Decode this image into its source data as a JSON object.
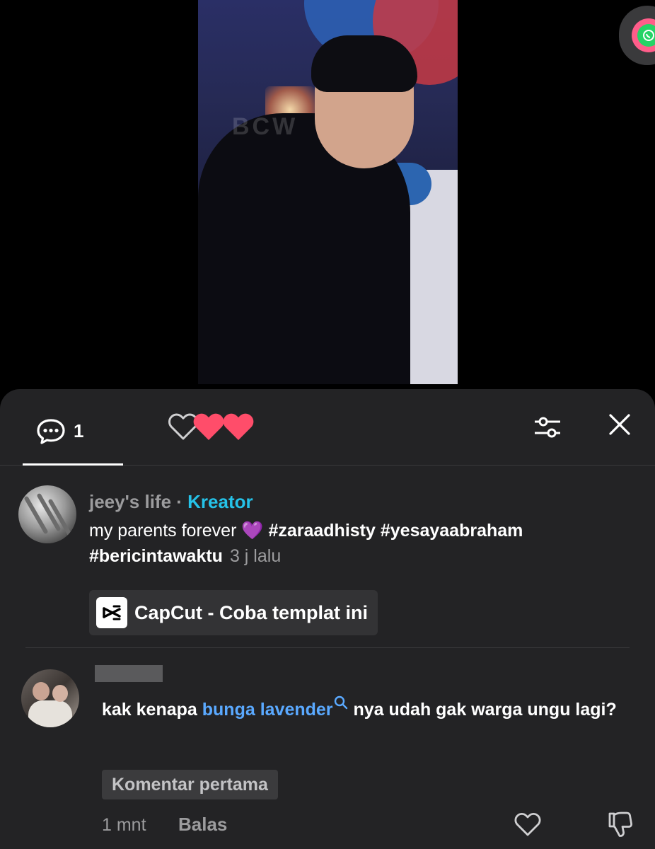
{
  "video": {
    "watermark": "BCW"
  },
  "sheet": {
    "comments_tab": {
      "count": "1"
    },
    "likes_tab": {
      "hearts": 2
    }
  },
  "post": {
    "username": "jeey's life",
    "separator": " · ",
    "role": "Kreator",
    "caption_text": "my parents forever 💜",
    "hashtags": [
      "#zaraadhisty",
      "#yesayaabraham",
      "#bericintawaktu"
    ],
    "time": "3 j lalu",
    "capcut_label": "CapCut - Coba templat ini"
  },
  "reply": {
    "text_before": "kak kenapa ",
    "link_text": "bunga lavender",
    "text_after": " nya udah gak warga ungu lagi?",
    "badge": "Komentar pertama",
    "time": "1 mnt",
    "reply_label": "Balas"
  },
  "colors": {
    "sheet_bg": "#232325",
    "creator_accent": "#25c2e8",
    "link": "#5aa9ff",
    "heart": "#ff4d6a"
  }
}
